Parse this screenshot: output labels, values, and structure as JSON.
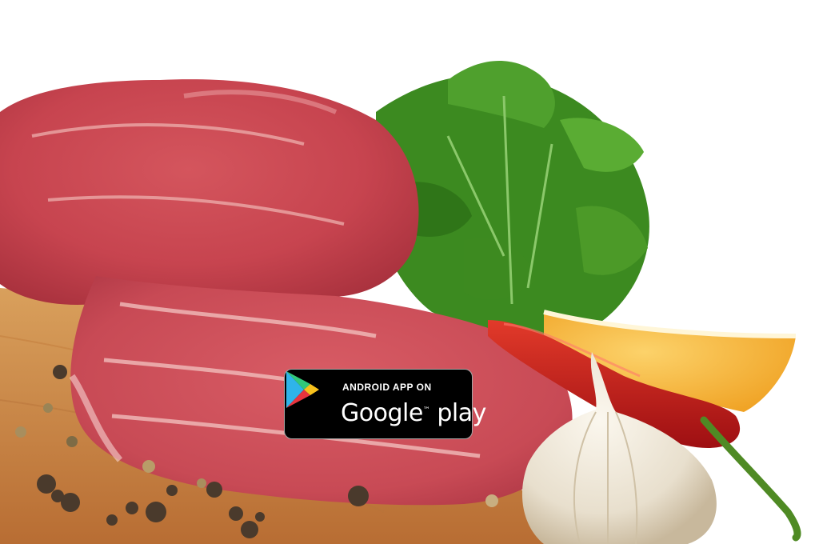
{
  "badge": {
    "top_line": "ANDROID APP ON",
    "brand": "Google",
    "brand_suffix": "play",
    "trademark": "™"
  },
  "colors": {
    "background": "#ffffff",
    "board": "#c98a4a",
    "meat": "#c9434f",
    "parsley": "#3e8a22",
    "lemon": "#f6b23a",
    "pepper": "#c41818",
    "garlic": "#ece4d4",
    "badge_bg": "#000000"
  }
}
